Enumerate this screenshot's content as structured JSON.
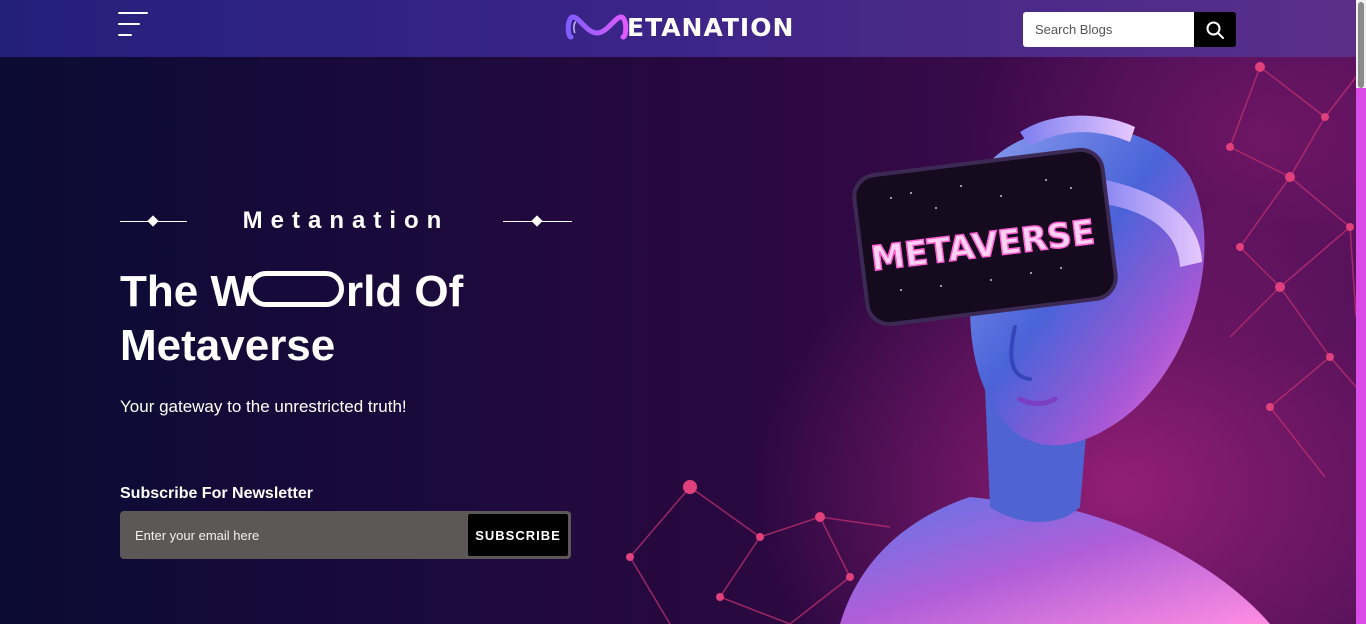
{
  "header": {
    "brand": "ETANATION",
    "search": {
      "placeholder": "Search Blogs",
      "value": ""
    }
  },
  "hero": {
    "kicker": "Metanation",
    "title_line1_start": "The W",
    "title_line1_end": "rld Of",
    "title_line2": "Metaverse",
    "subtitle": "Your gateway to the unrestricted truth!",
    "headset_text": "METAVERSE"
  },
  "newsletter": {
    "label": "Subscribe For Newsletter",
    "placeholder": "Enter your email here",
    "button_label": "SUBSCRIBE"
  },
  "colors": {
    "header_start": "#23207a",
    "header_end": "#5a2f8a",
    "accent_pink": "#e24bd0",
    "hero_dark": "#0b0b33"
  },
  "icons": [
    "menu-icon",
    "search-icon",
    "logo-mark-icon"
  ]
}
